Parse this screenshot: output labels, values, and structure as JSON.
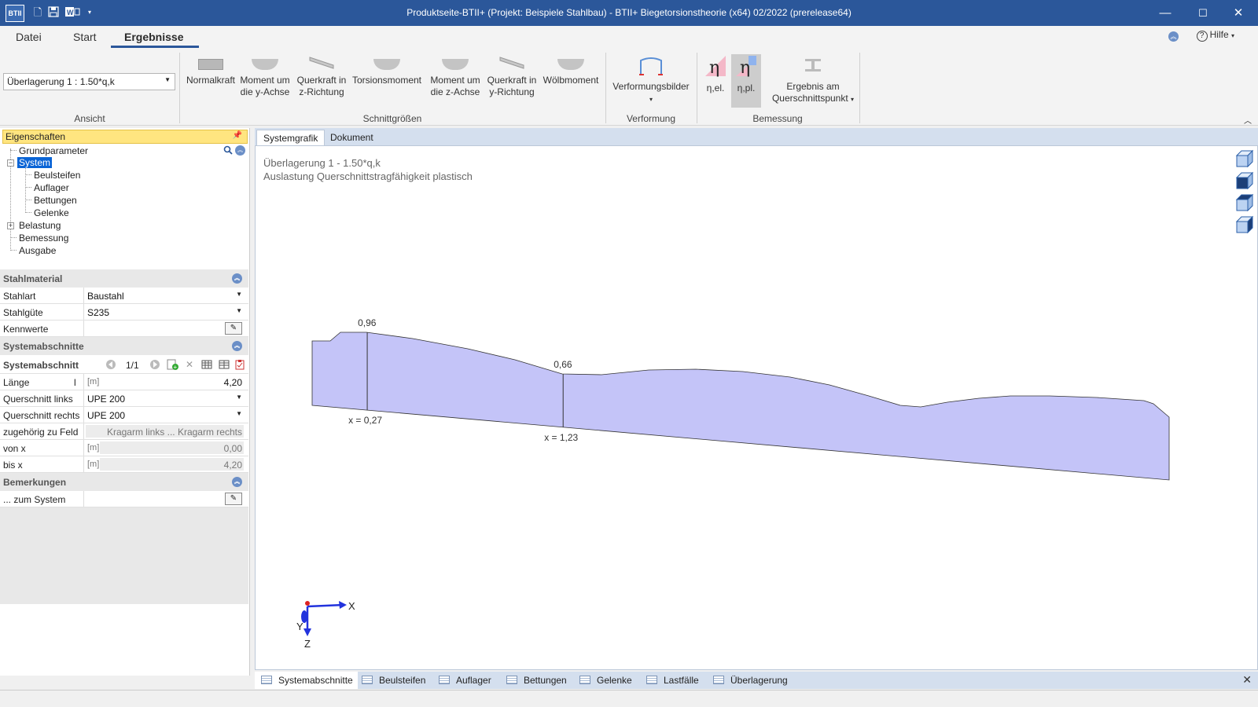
{
  "titlebar": {
    "logo": "BTII",
    "title": "Produktseite-BTII+ (Projekt: Beispiele Stahlbau) - BTII+ Biegetorsionstheorie (x64) 02/2022 (prerelease64)",
    "quick_access_icons": [
      "new-file-icon",
      "save-icon",
      "word-export-icon",
      "customize-arrow-icon"
    ],
    "minimize": "—",
    "maximize": "☐",
    "close": "✕"
  },
  "ribbon_tabs": [
    "Datei",
    "Start",
    "Ergebnisse"
  ],
  "active_tab": "Ergebnisse",
  "help_label": "Hilfe",
  "ribbon": {
    "ansicht": {
      "combo_value": "Überlagerung 1 : 1.50*q,k",
      "label": "Ansicht"
    },
    "schnittgroessen": {
      "label": "Schnittgrößen",
      "buttons": [
        {
          "line1": "Normalkraft",
          "line2": ""
        },
        {
          "line1": "Moment um",
          "line2": "die y-Achse"
        },
        {
          "line1": "Querkraft in",
          "line2": "z-Richtung"
        },
        {
          "line1": "Torsionsmoment",
          "line2": ""
        },
        {
          "line1": "Moment um",
          "line2": "die z-Achse"
        },
        {
          "line1": "Querkraft in",
          "line2": "y-Richtung"
        },
        {
          "line1": "Wölbmoment",
          "line2": ""
        }
      ]
    },
    "verformung": {
      "label": "Verformung",
      "button": "Verformungsbilder"
    },
    "bemessung": {
      "label": "Bemessung",
      "eta_el": "η,el.",
      "eta_pl": "η,pl.",
      "ergebnis_line1": "Ergebnis am",
      "ergebnis_line2": "Querschnittspunkt"
    }
  },
  "properties": {
    "header": "Eigenschaften",
    "tree": {
      "grundparameter": "Grundparameter",
      "system": "System",
      "beulsteifen": "Beulsteifen",
      "auflager": "Auflager",
      "bettungen": "Bettungen",
      "gelenke": "Gelenke",
      "belastung": "Belastung",
      "bemessung": "Bemessung",
      "ausgabe": "Ausgabe"
    },
    "stahlmaterial": {
      "header": "Stahlmaterial",
      "stahlart_label": "Stahlart",
      "stahlart_value": "Baustahl",
      "stahlguete_label": "Stahlgüte",
      "stahlguete_value": "S235",
      "kennwerte_label": "Kennwerte"
    },
    "systemabschnitte": {
      "header": "Systemabschnitte",
      "abschnitt_label": "Systemabschnitt",
      "abschnitt_page": "1/1",
      "laenge_label": "Länge",
      "laenge_sym": "l",
      "laenge_unit": "[m]",
      "laenge_value": "4,20",
      "qs_links_label": "Querschnitt links",
      "qs_links_value": "UPE 200",
      "qs_rechts_label": "Querschnitt rechts",
      "qs_rechts_value": "UPE 200",
      "feld_label": "zugehörig zu Feld",
      "feld_value": "Kragarm links ... Kragarm rechts",
      "von_label": "von x",
      "von_unit": "[m]",
      "von_value": "0,00",
      "bis_label": "bis x",
      "bis_unit": "[m]",
      "bis_value": "4,20"
    },
    "bemerkungen": {
      "header": "Bemerkungen",
      "zum_system_label": "... zum System"
    }
  },
  "view_tabs": [
    "Systemgrafik",
    "Dokument"
  ],
  "canvas": {
    "title_line1": "Überlagerung 1 - 1.50*q,k",
    "title_line2": "Auslastung Querschnittstragfähigkeit plastisch",
    "axis_x": "X",
    "axis_y": "Y",
    "axis_z": "Z"
  },
  "chart_data": {
    "type": "area",
    "title": "Auslastung Querschnittstragfähigkeit plastisch",
    "x_range": [
      0,
      4.2
    ],
    "annotations": [
      {
        "label": "0,96",
        "x": 0.27
      },
      {
        "label": "0,66",
        "x": 1.23
      }
    ],
    "x_labels": [
      "x = 0,27",
      "x = 1,23"
    ],
    "fill_color": "#c4c4f8",
    "stroke_color": "#333333"
  },
  "bottom_tabs": [
    "Systemabschnitte",
    "Beulsteifen",
    "Auflager",
    "Bettungen",
    "Gelenke",
    "Lastfälle",
    "Überlagerung"
  ],
  "colors": {
    "titlebar": "#2b579a",
    "selection": "#0a64d6",
    "panel_header": "#ffe580"
  }
}
